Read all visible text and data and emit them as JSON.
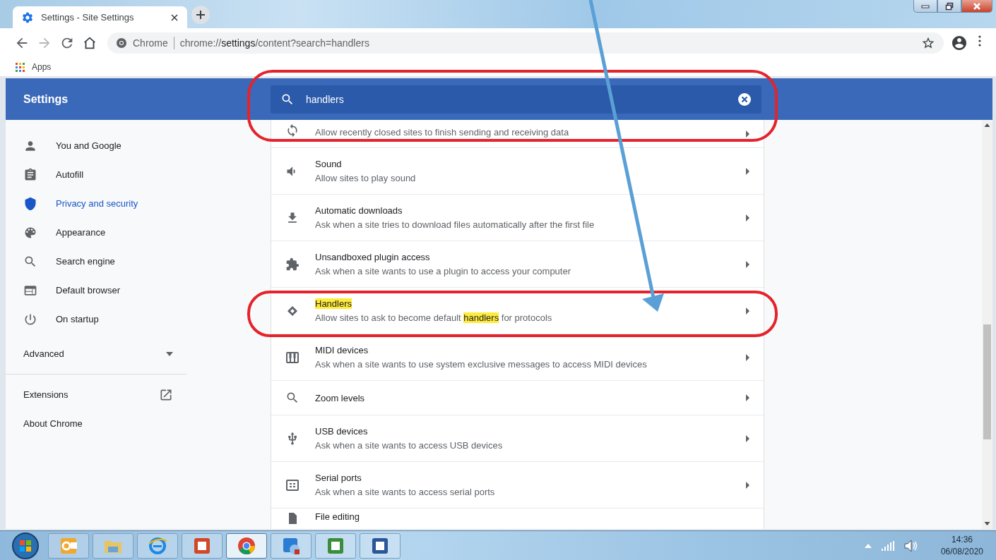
{
  "tabs": [
    {
      "title": "Settings - Site Settings",
      "selected": true
    }
  ],
  "toolbar": {
    "omnibox_chip": "Chrome",
    "url": {
      "scheme": "chrome://",
      "host": "settings",
      "path": "/content?search=handlers"
    }
  },
  "bookmarks": [
    {
      "label": "Apps"
    }
  ],
  "header": {
    "title": "Settings",
    "search": {
      "value": "handlers"
    }
  },
  "sidebar": {
    "items": [
      {
        "label": "You and Google",
        "selected": false
      },
      {
        "label": "Autofill",
        "selected": false
      },
      {
        "label": "Privacy and security",
        "selected": true
      },
      {
        "label": "Appearance",
        "selected": false
      },
      {
        "label": "Search engine",
        "selected": false
      },
      {
        "label": "Default browser",
        "selected": false
      },
      {
        "label": "On startup",
        "selected": false
      }
    ],
    "advanced": {
      "label": "Advanced",
      "expanded": false
    },
    "links": [
      {
        "label": "Extensions",
        "kind": "external"
      },
      {
        "label": "About Chrome",
        "kind": "plain"
      }
    ]
  },
  "site_settings": [
    {
      "subtitle": [
        {
          "text": "Allow recently closed sites to finish sending and receiving data",
          "highlighted": false
        }
      ]
    },
    {
      "title": [
        {
          "text": "Sound",
          "highlighted": false
        }
      ],
      "subtitle": [
        {
          "text": "Allow sites to play sound",
          "highlighted": false
        }
      ]
    },
    {
      "title": [
        {
          "text": "Automatic downloads",
          "highlighted": false
        }
      ],
      "subtitle": [
        {
          "text": "Ask when a site tries to download files automatically after the first file",
          "highlighted": false
        }
      ]
    },
    {
      "title": [
        {
          "text": "Unsandboxed plugin access",
          "highlighted": false
        }
      ],
      "subtitle": [
        {
          "text": "Ask when a site wants to use a plugin to access your computer",
          "highlighted": false
        }
      ]
    },
    {
      "title": [
        {
          "text": "Handlers",
          "highlighted": true
        }
      ],
      "subtitle": [
        {
          "text": "Allow sites to ask to become default ",
          "highlighted": false
        },
        {
          "text": "handlers",
          "highlighted": true
        },
        {
          "text": " for protocols",
          "highlighted": false
        }
      ]
    },
    {
      "title": [
        {
          "text": "MIDI devices",
          "highlighted": false
        }
      ],
      "subtitle": [
        {
          "text": "Ask when a site wants to use system exclusive messages to access MIDI devices",
          "highlighted": false
        }
      ]
    },
    {
      "title": [
        {
          "text": "Zoom levels",
          "highlighted": false
        }
      ]
    },
    {
      "title": [
        {
          "text": "USB devices",
          "highlighted": false
        }
      ],
      "subtitle": [
        {
          "text": "Ask when a site wants to access USB devices",
          "highlighted": false
        }
      ]
    },
    {
      "title": [
        {
          "text": "Serial ports",
          "highlighted": false
        }
      ],
      "subtitle": [
        {
          "text": "Ask when a site wants to access serial ports",
          "highlighted": false
        }
      ]
    },
    {
      "title": [
        {
          "text": "File editing",
          "highlighted": false
        }
      ]
    }
  ],
  "taskbar": {
    "buttons": [
      {
        "selected": false
      },
      {
        "selected": false
      },
      {
        "selected": false
      },
      {
        "selected": false
      },
      {
        "selected": true
      },
      {
        "selected": false
      },
      {
        "selected": false
      },
      {
        "selected": false
      }
    ],
    "clock": {
      "time": "14:36",
      "date": "06/08/2020"
    }
  }
}
